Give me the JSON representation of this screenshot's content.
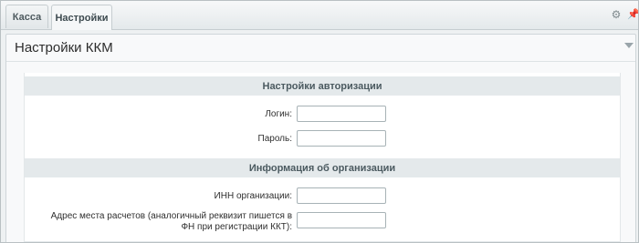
{
  "tabs": [
    {
      "label": "Касса",
      "active": false
    },
    {
      "label": "Настройки",
      "active": true
    }
  ],
  "toolbar": {
    "settings_icon": "gear-icon",
    "pin_icon": "pin-icon"
  },
  "panel": {
    "title": "Настройки ККМ",
    "collapse_icon": "triangle-down-icon"
  },
  "sections": {
    "auth": {
      "title": "Настройки авторизации",
      "login_label": "Логин:",
      "login_value": "",
      "password_label": "Пароль:",
      "password_value": ""
    },
    "org": {
      "title": "Информация об организации",
      "inn_label": "ИНН организации:",
      "inn_value": "",
      "address_label": "Адрес места расчетов (аналогичный реквизит пишется в ФН при регистрации ККТ):",
      "address_value": ""
    }
  },
  "colors": {
    "background": "#e6ebed",
    "section_header": "#e4e9eb",
    "input_border": "#a7b2b6"
  }
}
